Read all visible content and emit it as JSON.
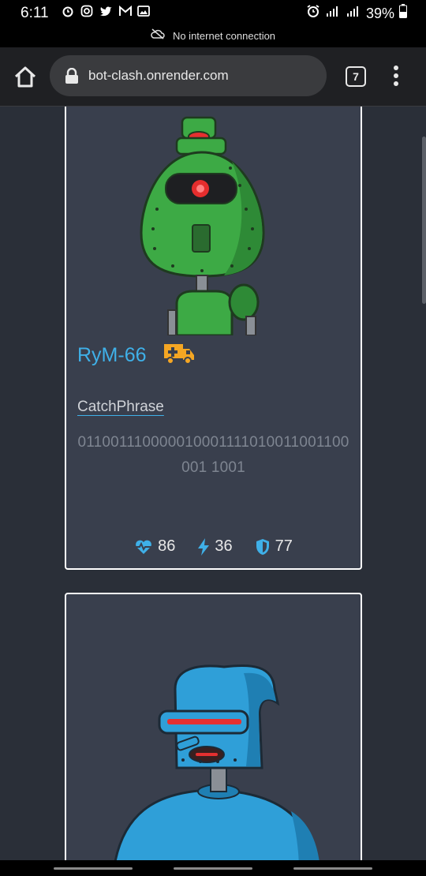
{
  "status_bar": {
    "time": "6:11",
    "battery": "39%"
  },
  "connection": {
    "text": "No internet connection"
  },
  "browser": {
    "url": "bot-clash.onrender.com",
    "tab_count": "7"
  },
  "cards": [
    {
      "name": "RyM-66",
      "badge_icon": "ambulance-icon",
      "catchphrase_label": "CatchPhrase",
      "catchphrase": "011001110000010001111010011001100001 1001",
      "stats": {
        "health": "86",
        "attack": "36",
        "defense": "77"
      },
      "colors": {
        "accent": "#3fb0e8",
        "badge": "#f5a623",
        "body": "#3daa45"
      }
    },
    {
      "name": "",
      "colors": {
        "body": "#2f9fd8"
      }
    }
  ]
}
